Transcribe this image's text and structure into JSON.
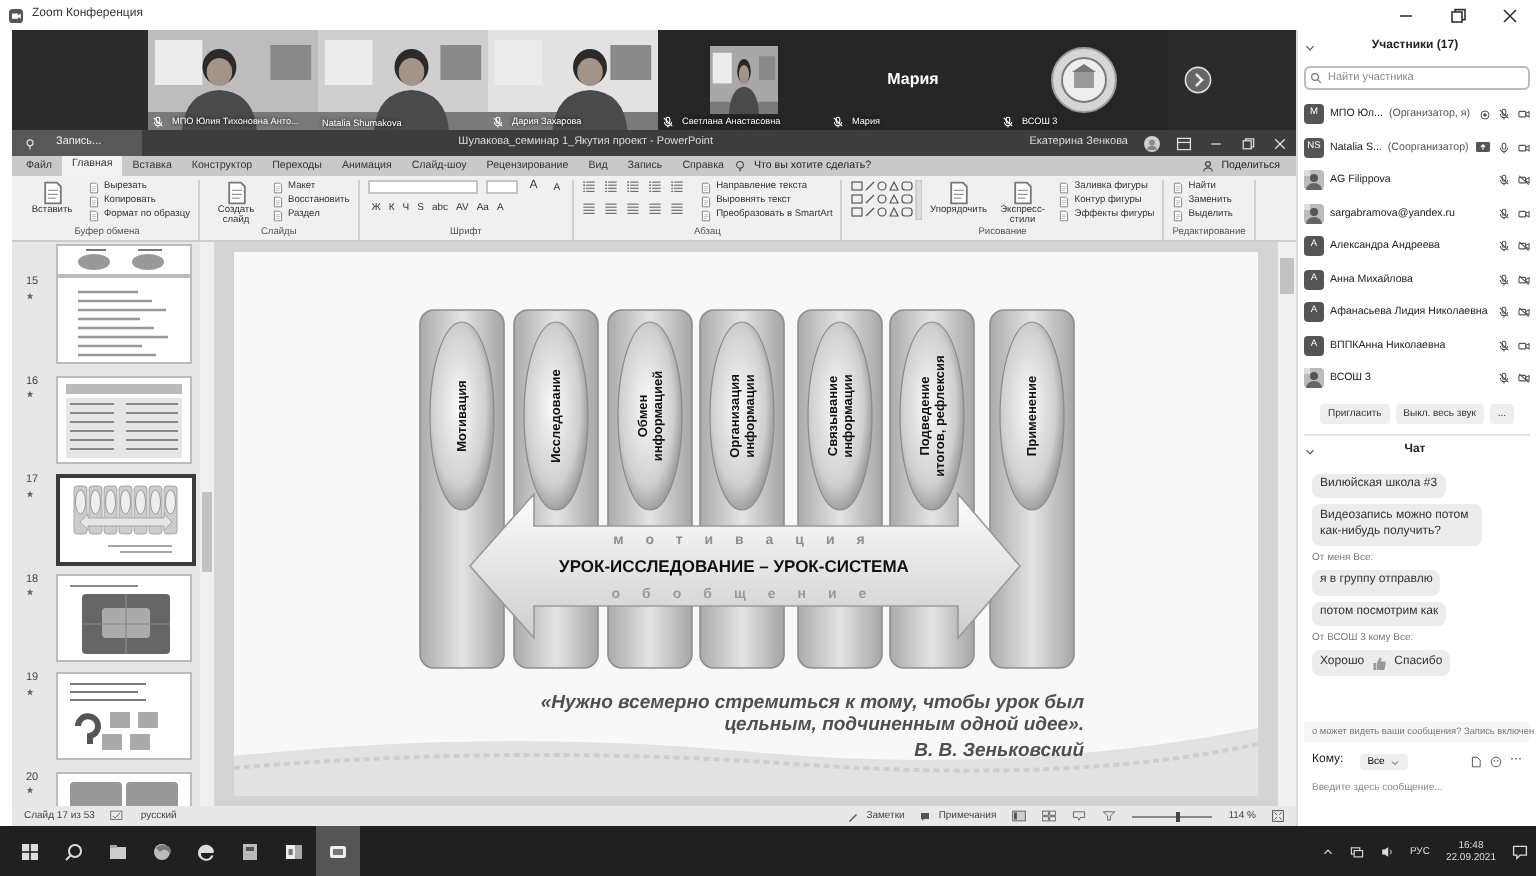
{
  "app": {
    "title": "Zoom Конференция"
  },
  "video_strip": {
    "tiles": [
      {
        "kind": "picture",
        "name": "МПО Юлия Тихоновна Анто...",
        "muted": true
      },
      {
        "kind": "picture",
        "name": "Natalia Shumakova",
        "muted": false
      },
      {
        "kind": "picture",
        "name": "Дария Захарова",
        "muted": true
      },
      {
        "kind": "small-picture",
        "name": "Светлана Анастасовна",
        "muted": true
      },
      {
        "kind": "name-only",
        "display_name": "Мария",
        "name": "Мария",
        "muted": true
      },
      {
        "kind": "logo",
        "name": "ВСОШ 3",
        "muted": true
      }
    ]
  },
  "powerpoint": {
    "record_button": "Запись...",
    "title": "Шулакова_семинар 1_Якутия проект - PowerPoint",
    "user": "Екатерина Зенкова",
    "tabs": [
      {
        "label": "Файл",
        "selected": false
      },
      {
        "label": "Главная",
        "selected": true
      },
      {
        "label": "Вставка",
        "selected": false
      },
      {
        "label": "Конструктор",
        "selected": false
      },
      {
        "label": "Переходы",
        "selected": false
      },
      {
        "label": "Анимация",
        "selected": false
      },
      {
        "label": "Слайд-шоу",
        "selected": false
      },
      {
        "label": "Рецензирование",
        "selected": false
      },
      {
        "label": "Вид",
        "selected": false
      },
      {
        "label": "Запись",
        "selected": false
      },
      {
        "label": "Справка",
        "selected": false
      }
    ],
    "tell_me": "Что вы хотите сделать?",
    "share": "Поделиться",
    "ribbon": [
      {
        "kind": "clipboard",
        "name": "Буфер обмена",
        "big": [
          "Вставить"
        ],
        "small": [
          "Вырезать",
          "Копировать",
          "Формат по образцу"
        ]
      },
      {
        "kind": "slides",
        "name": "Слайды",
        "big": [
          "Создать слайд"
        ],
        "small": [
          "Макет",
          "Восстановить",
          "Раздел"
        ]
      },
      {
        "kind": "font",
        "name": "Шрифт",
        "size_buttons": [
          "A",
          "A"
        ],
        "buttons": [
          "Ж",
          "К",
          "Ч",
          "S",
          "abc",
          "AV",
          "Aa",
          "A"
        ]
      },
      {
        "kind": "paragraph",
        "name": "Абзац",
        "small": [
          "Направление текста",
          "Выровнять текст",
          "Преобразовать в SmartArt"
        ]
      },
      {
        "kind": "drawing",
        "name": "Рисование",
        "big": [
          "Упорядочить",
          "Экспресс-стили"
        ],
        "small": [
          "Заливка фигуры",
          "Контур фигуры",
          "Эффекты фигуры"
        ]
      },
      {
        "kind": "editing",
        "name": "Редактирование",
        "small": [
          "Найти",
          "Заменить",
          "Выделить"
        ]
      }
    ],
    "thumbnails": [
      {
        "kind": "tail",
        "selected": false
      },
      {
        "kind": "bullets",
        "number": "15",
        "selected": false
      },
      {
        "kind": "table",
        "number": "16",
        "selected": false
      },
      {
        "kind": "columns",
        "number": "17",
        "selected": true
      },
      {
        "kind": "quadrant",
        "number": "18",
        "selected": false
      },
      {
        "kind": "question",
        "number": "19",
        "selected": false
      },
      {
        "kind": "boxes",
        "number": "20",
        "selected": false
      }
    ],
    "slide": {
      "columns": [
        {
          "lines": [
            "Мотивация"
          ]
        },
        {
          "lines": [
            "Исследование"
          ]
        },
        {
          "lines": [
            "Обмен",
            "информацией"
          ]
        },
        {
          "lines": [
            "Организация",
            "информации"
          ]
        },
        {
          "lines": [
            "Связывание",
            "информации"
          ]
        },
        {
          "lines": [
            "Подведение",
            "итогов, рефлексия"
          ]
        },
        {
          "lines": [
            "Применение"
          ]
        }
      ],
      "arrow_title": "УРОК-ИССЛЕДОВАНИЕ – УРОК-СИСТЕМА",
      "arrow_top": "мотивация",
      "arrow_bottom": "обобщение",
      "quote": "«Нужно всемерно стремиться к тому, чтобы урок был цельным, подчиненным одной идее».",
      "author": "В. В. Зеньковский"
    },
    "status_bar": {
      "slide_counter": "Слайд 17 из 53",
      "language": "русский",
      "notes": "Заметки",
      "comments": "Примечания",
      "zoom_slider": {
        "level": 0.55
      },
      "zoom": "114 %"
    }
  },
  "participants": {
    "title": "Участники (17)",
    "search_placeholder": "Найти участника",
    "people": [
      {
        "kind": "letter",
        "initials": "M",
        "name": "МПО Юл...",
        "role": "(Организатор, я)",
        "recording": true,
        "sharing": false,
        "muted": true,
        "video": true
      },
      {
        "kind": "letter",
        "initials": "NS",
        "name": "Natalia S...",
        "role": "(Соорганизатор)",
        "recording": false,
        "sharing": true,
        "muted": false,
        "video": true
      },
      {
        "kind": "picture",
        "name": "AG Filippova",
        "recording": false,
        "sharing": false,
        "muted": true,
        "video": false
      },
      {
        "kind": "picture",
        "name": "sargabramova@yandex.ru",
        "recording": false,
        "sharing": false,
        "muted": true,
        "video": true
      },
      {
        "kind": "letter",
        "initials": "A",
        "name": "Александра Андреева",
        "recording": false,
        "sharing": false,
        "muted": true,
        "video": false
      },
      {
        "kind": "letter",
        "initials": "A",
        "name": "Анна Михайлова",
        "recording": false,
        "sharing": false,
        "muted": true,
        "video": false
      },
      {
        "kind": "letter",
        "initials": "A",
        "name": "Афанасьева Лидия Николаевна",
        "recording": false,
        "sharing": false,
        "muted": true,
        "video": false
      },
      {
        "kind": "letter",
        "initials": "A",
        "name": "ВППКАнна Николаевна",
        "recording": false,
        "sharing": false,
        "muted": true,
        "video": true
      },
      {
        "kind": "picture",
        "name": "ВСОШ 3",
        "recording": false,
        "sharing": false,
        "muted": true,
        "video": false
      }
    ],
    "buttons": [
      "Пригласить",
      "Выкл. весь звук",
      "..."
    ]
  },
  "chat": {
    "title": "Чат",
    "items": [
      {
        "kind": "message",
        "text": "Вилюйская школа #3"
      },
      {
        "kind": "message",
        "text": "Видеозапись можно потом как-нибудь получить?"
      },
      {
        "kind": "sender",
        "text": "От меня Все:"
      },
      {
        "kind": "message",
        "text": "я в группу отправлю"
      },
      {
        "kind": "message",
        "text": "потом посмотрим как"
      },
      {
        "kind": "sender",
        "text": "От ВСОШ 3 кому Все:"
      },
      {
        "kind": "emoji-message",
        "text": "Хорошо",
        "after": "Спасибо"
      }
    ],
    "notice": "о может видеть ваши сообщения? Запись включен",
    "to_label": "Кому:",
    "to_value": "Все",
    "more": "···",
    "placeholder": "Введите здесь сообщение..."
  },
  "taskbar": {
    "apps": [
      {
        "kind": "start",
        "active": false
      },
      {
        "kind": "search",
        "active": false
      },
      {
        "kind": "files",
        "active": false
      },
      {
        "kind": "browser",
        "active": false
      },
      {
        "kind": "edge",
        "active": false
      },
      {
        "kind": "book",
        "active": false
      },
      {
        "kind": "powerpoint",
        "active": false
      },
      {
        "kind": "zoom",
        "active": true
      }
    ],
    "language": "РУС",
    "time": "16:48",
    "date": "22.09.2021"
  }
}
